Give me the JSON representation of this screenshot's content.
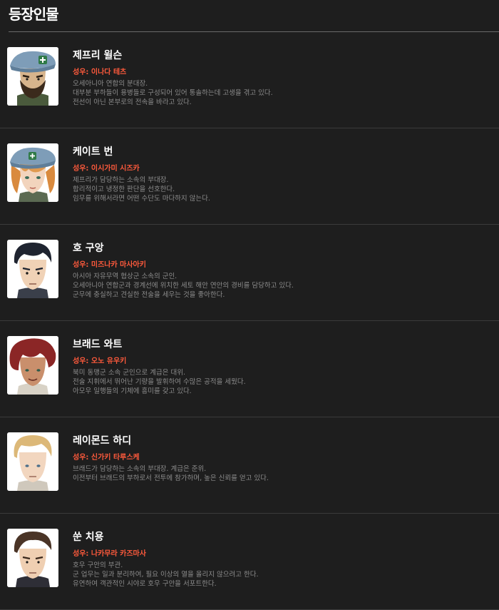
{
  "section": {
    "title": "등장인물"
  },
  "accent_color": "#ff5a3c",
  "characters": [
    {
      "name": "제프리 윌슨",
      "voice": "성우: 이나다 테츠",
      "desc": [
        "오세아니아 연합의 분대장.",
        "대부분 부하들이 용병들로 구성되어 있어 통솔하는데 고생을 겪고 있다.",
        "전선이 아닌 본부로의 전속을 바라고 있다."
      ],
      "avatar_icon": "bearded-officer-portrait-icon"
    },
    {
      "name": "케이트 번",
      "voice": "성우: 이시가미 시즈카",
      "desc": [
        "제프리가 담당하는 소속의 부대장.",
        "합리적이고 냉정한 판단을 선호한다.",
        "임무를 위해서라면 어떤 수단도 마다하지 않는다."
      ],
      "avatar_icon": "female-officer-portrait-icon"
    },
    {
      "name": "호 구앙",
      "voice": "성우: 미즈나카 마사아키",
      "desc": [
        "아시아 자유무역 협상군 소속의 군인.",
        "오세아니아 연합군과 경계선에 위치한 세토 해안 연안의 경비를 담당하고 있다.",
        "군무에 충실하고 견실한 전술을 세우는 것을 좋아한다."
      ],
      "avatar_icon": "dark-haired-soldier-portrait-icon"
    },
    {
      "name": "브래드 와트",
      "voice": "성우: 오노 유우키",
      "desc": [
        "북미 동맹군 소속 군인으로 계급은 대위.",
        "전술 지휘에서 뛰어난 기량을 발휘하여 수많은 공적을 세웠다.",
        "아모우 일행들의 기체에 흥미를 갖고 있다."
      ],
      "avatar_icon": "red-haired-soldier-portrait-icon"
    },
    {
      "name": "레이몬드 하디",
      "voice": "성우: 신가키 타루스케",
      "desc": [
        "브래드가 담당하는 소속의 부대장. 계급은 준위.",
        "이전부터 브래드의 부하로서 전투에 참가하며, 높은 신뢰를 얻고 있다."
      ],
      "avatar_icon": "blond-soldier-portrait-icon"
    },
    {
      "name": "쑨 치용",
      "voice": "성우: 나카무라 카즈마사",
      "desc": [
        "호우 구안의 부관.",
        "군 업무는 일과 분리하여, 필요 이상의 열을 올리지 않으려고 한다.",
        "유연하여 객관적인 시야로 호우 구안을 서포트한다."
      ],
      "avatar_icon": "brown-haired-officer-portrait-icon"
    }
  ]
}
